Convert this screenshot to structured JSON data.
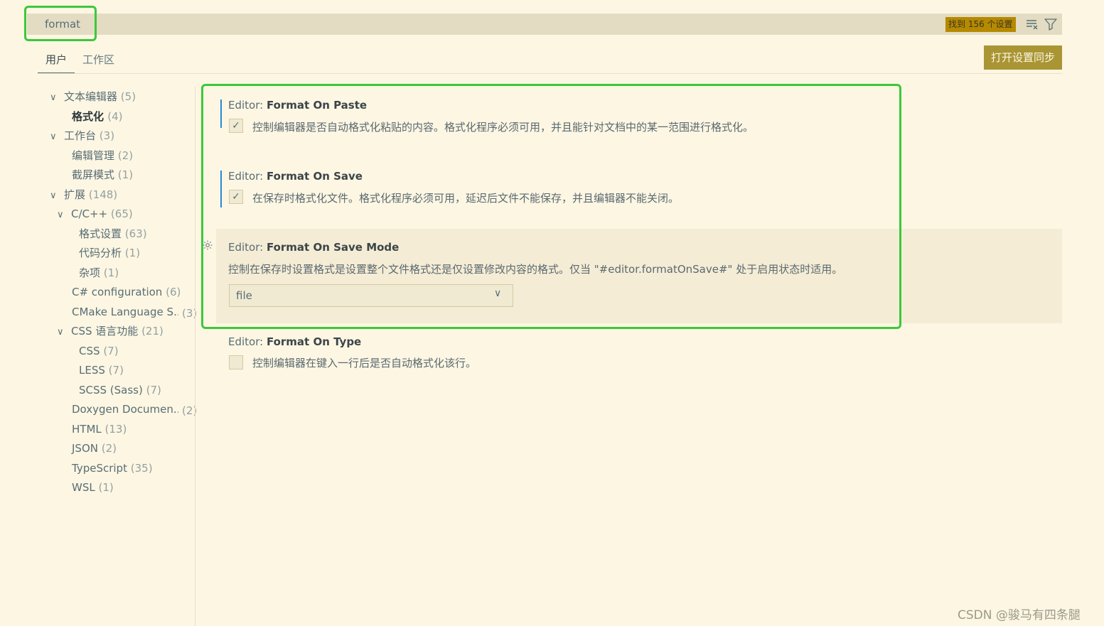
{
  "search": {
    "value": "format",
    "result_count": "找到 156 个设置"
  },
  "toolbar": {
    "clear_icon": "clear-filter-icon",
    "filter_icon": "filter-icon"
  },
  "tabs": [
    {
      "label": "用户"
    },
    {
      "label": "工作区"
    }
  ],
  "sync_button": "打开设置同步",
  "toc": {
    "text_editor": {
      "label": "文本编辑器",
      "count": "(5)"
    },
    "formatting": {
      "label": "格式化",
      "count": "(4)"
    },
    "workbench": {
      "label": "工作台",
      "count": "(3)"
    },
    "editor_management": {
      "label": "编辑管理",
      "count": "(2)"
    },
    "zen_mode": {
      "label": "截屏模式",
      "count": "(1)"
    },
    "extensions": {
      "label": "扩展",
      "count": "(148)"
    },
    "cpp": {
      "label": "C/C++",
      "count": "(65)"
    },
    "format_settings": {
      "label": "格式设置",
      "count": "(63)"
    },
    "code_analysis": {
      "label": "代码分析",
      "count": "(1)"
    },
    "misc": {
      "label": "杂项",
      "count": "(1)"
    },
    "csharp": {
      "label": "C# configuration",
      "count": "(6)"
    },
    "cmake": {
      "label": "CMake Language S...",
      "count": "(3)"
    },
    "css_lang": {
      "label": "CSS 语言功能",
      "count": "(21)"
    },
    "css": {
      "label": "CSS",
      "count": "(7)"
    },
    "less": {
      "label": "LESS",
      "count": "(7)"
    },
    "scss": {
      "label": "SCSS (Sass)",
      "count": "(7)"
    },
    "doxygen": {
      "label": "Doxygen Documen...",
      "count": "(2)"
    },
    "html": {
      "label": "HTML",
      "count": "(13)"
    },
    "json": {
      "label": "JSON",
      "count": "(2)"
    },
    "typescript": {
      "label": "TypeScript",
      "count": "(35)"
    },
    "wsl": {
      "label": "WSL",
      "count": "(1)"
    }
  },
  "settings": {
    "paste": {
      "prefix": "Editor: ",
      "name": "Format On Paste",
      "checked": true,
      "description": "控制编辑器是否自动格式化粘贴的内容。格式化程序必须可用，并且能针对文档中的某一范围进行格式化。"
    },
    "save": {
      "prefix": "Editor: ",
      "name": "Format On Save",
      "checked": true,
      "description": "在保存时格式化文件。格式化程序必须可用，延迟后文件不能保存，并且编辑器不能关闭。"
    },
    "save_mode": {
      "prefix": "Editor: ",
      "name": "Format On Save Mode",
      "description": "控制在保存时设置格式是设置整个文件格式还是仅设置修改内容的格式。仅当 \"#editor.formatOnSave#\" 处于启用状态时适用。",
      "value": "file"
    },
    "type": {
      "prefix": "Editor: ",
      "name": "Format On Type",
      "checked": false,
      "description": "控制编辑器在键入一行后是否自动格式化该行。"
    }
  },
  "checkmark": "✓",
  "chevron_down": "∨",
  "watermark": "CSDN @骏马有四条腿",
  "colors": {
    "highlight": "#3cc83c",
    "badge": "#b58900",
    "sync_button": "#a99533",
    "background": "#fdf6e3"
  }
}
